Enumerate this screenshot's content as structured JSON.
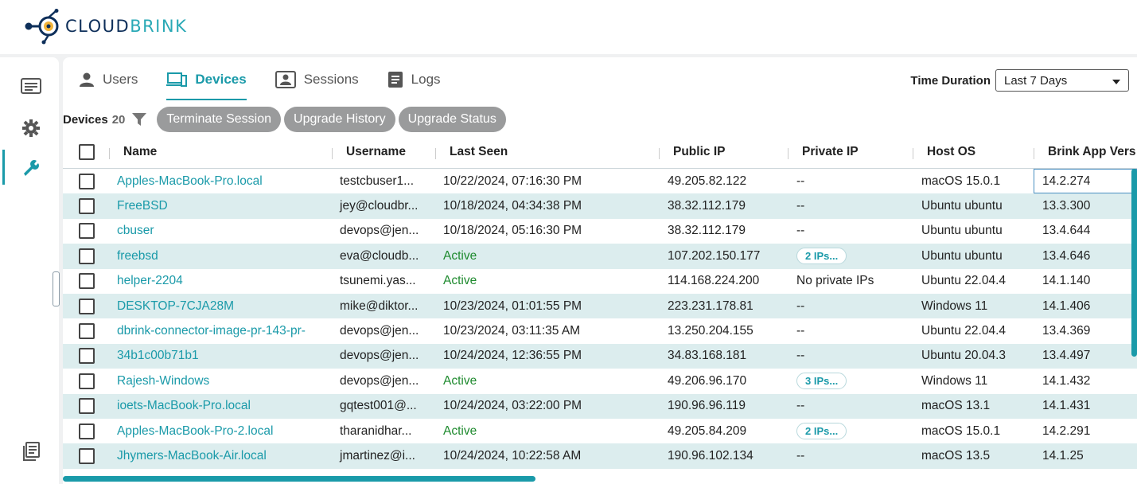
{
  "app": {
    "logo_text_a": "CLOUD",
    "logo_text_b": "BRINK"
  },
  "tabs": [
    {
      "label": "Users",
      "icon": "user-icon"
    },
    {
      "label": "Devices",
      "icon": "devices-icon"
    },
    {
      "label": "Sessions",
      "icon": "sessions-icon"
    },
    {
      "label": "Logs",
      "icon": "logs-icon"
    }
  ],
  "time_duration": {
    "label": "Time Duration",
    "value": "Last 7 Days"
  },
  "toolbar": {
    "devices_label": "Devices",
    "devices_count": "20",
    "terminate": "Terminate Session",
    "upgrade_history": "Upgrade History",
    "upgrade_status": "Upgrade Status"
  },
  "columns": {
    "name": "Name",
    "username": "Username",
    "last_seen": "Last Seen",
    "public_ip": "Public IP",
    "private_ip": "Private IP",
    "host_os": "Host OS",
    "app_version": "Brink App Vers"
  },
  "rows": [
    {
      "name": "Apples-MacBook-Pro.local",
      "username": "testcbuser1...",
      "last_seen": "10/22/2024, 07:16:30 PM",
      "public_ip": "49.205.82.122",
      "private_ip": "--",
      "host_os": "macOS 15.0.1",
      "app_version": "14.2.274"
    },
    {
      "name": "FreeBSD",
      "username": "jey@cloudbr...",
      "last_seen": "10/18/2024, 04:34:38 PM",
      "public_ip": "38.32.112.179",
      "private_ip": "--",
      "host_os": "Ubuntu ubuntu",
      "app_version": "13.3.300"
    },
    {
      "name": "cbuser",
      "username": "devops@jen...",
      "last_seen": "10/18/2024, 05:16:30 PM",
      "public_ip": "38.32.112.179",
      "private_ip": "--",
      "host_os": "Ubuntu ubuntu",
      "app_version": "13.4.644"
    },
    {
      "name": "freebsd",
      "username": "eva@cloudb...",
      "last_seen": "Active",
      "public_ip": "107.202.150.177",
      "private_ip": "2 IPs...",
      "host_os": "Ubuntu ubuntu",
      "app_version": "13.4.646"
    },
    {
      "name": "helper-2204",
      "username": "tsunemi.yas...",
      "last_seen": "Active",
      "public_ip": "114.168.224.200",
      "private_ip": "No private IPs",
      "host_os": "Ubuntu 22.04.4",
      "app_version": "14.1.140"
    },
    {
      "name": "DESKTOP-7CJA28M",
      "username": "mike@diktor...",
      "last_seen": "10/23/2024, 01:01:55 PM",
      "public_ip": "223.231.178.81",
      "private_ip": "--",
      "host_os": "Windows 11",
      "app_version": "14.1.406"
    },
    {
      "name": "dbrink-connector-image-pr-143-pr-",
      "username": "devops@jen...",
      "last_seen": "10/23/2024, 03:11:35 AM",
      "public_ip": "13.250.204.155",
      "private_ip": "--",
      "host_os": "Ubuntu 22.04.4",
      "app_version": "13.4.369"
    },
    {
      "name": "34b1c00b71b1",
      "username": "devops@jen...",
      "last_seen": "10/24/2024, 12:36:55 PM",
      "public_ip": "34.83.168.181",
      "private_ip": "--",
      "host_os": "Ubuntu 20.04.3",
      "app_version": "13.4.497"
    },
    {
      "name": "Rajesh-Windows",
      "username": "devops@jen...",
      "last_seen": "Active",
      "public_ip": "49.206.96.170",
      "private_ip": "3 IPs...",
      "host_os": "Windows 11",
      "app_version": "14.1.432"
    },
    {
      "name": "ioets-MacBook-Pro.local",
      "username": "gqtest001@...",
      "last_seen": "10/24/2024, 03:22:00 PM",
      "public_ip": "190.96.96.119",
      "private_ip": "--",
      "host_os": "macOS 13.1",
      "app_version": "14.1.431"
    },
    {
      "name": "Apples-MacBook-Pro-2.local",
      "username": "tharanidhar...",
      "last_seen": "Active",
      "public_ip": "49.205.84.209",
      "private_ip": "2 IPs...",
      "host_os": "macOS 15.0.1",
      "app_version": "14.2.291"
    },
    {
      "name": "Jhymers-MacBook-Air.local",
      "username": "jmartinez@i...",
      "last_seen": "10/24/2024, 10:22:58 AM",
      "public_ip": "190.96.102.134",
      "private_ip": "--",
      "host_os": "macOS 13.5",
      "app_version": "14.1.25"
    }
  ],
  "colors": {
    "accent": "#1a9aa9",
    "active_status": "#1e8a2e",
    "row_alt": "#dcedee",
    "pill": "#9a9b9c"
  }
}
